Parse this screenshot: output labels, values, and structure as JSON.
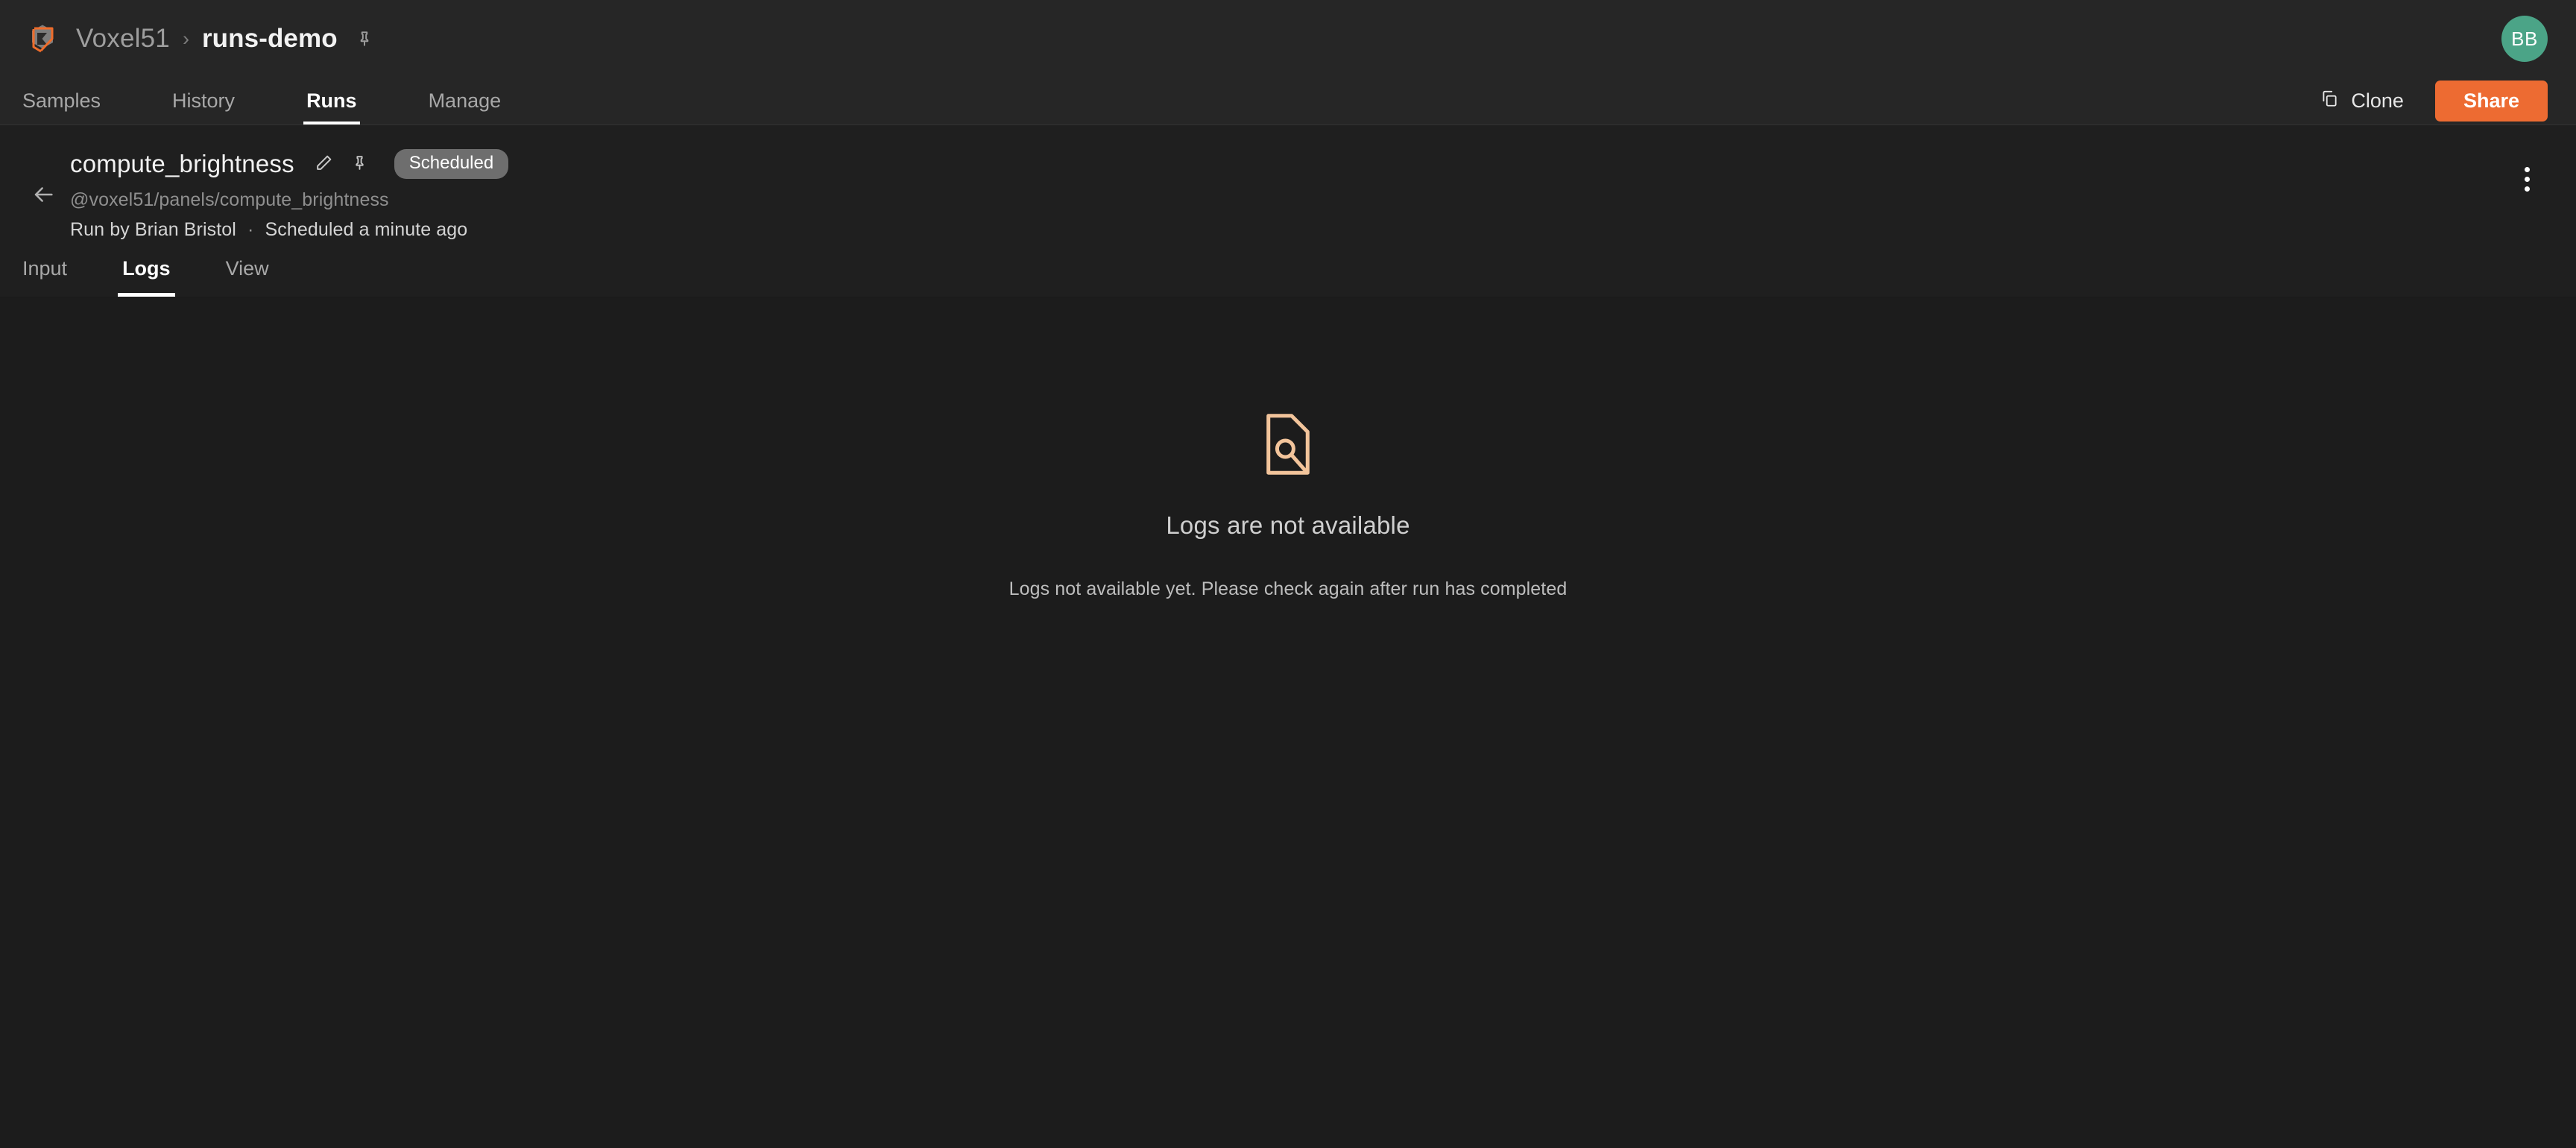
{
  "topbar": {
    "logo": "voxel51-logo",
    "breadcrumb": {
      "org": "Voxel51",
      "separator": "›",
      "current": "runs-demo",
      "pin_icon": "pin-icon"
    },
    "avatar_initials": "BB",
    "avatar_color": "#4ba487"
  },
  "nav": {
    "tabs": [
      {
        "label": "Samples",
        "active": false
      },
      {
        "label": "History",
        "active": false
      },
      {
        "label": "Runs",
        "active": true
      },
      {
        "label": "Manage",
        "active": false
      }
    ],
    "clone_label": "Clone",
    "clone_icon": "copy-icon",
    "share_label": "Share",
    "share_color": "#ed6b32"
  },
  "run": {
    "back_icon": "arrow-left-icon",
    "title": "compute_brightness",
    "edit_icon": "pencil-icon",
    "pin_icon": "pin-icon",
    "status": "Scheduled",
    "status_color": "#6e6e6e",
    "uri": "@voxel51/panels/compute_brightness",
    "run_by": "Run by Brian Bristol",
    "meta_separator": "·",
    "scheduled_at": "Scheduled a minute ago",
    "more_icon": "kebab-menu-icon"
  },
  "subtabs": [
    {
      "label": "Input",
      "active": false
    },
    {
      "label": "Logs",
      "active": true
    },
    {
      "label": "View",
      "active": false
    }
  ],
  "empty_state": {
    "icon": "document-search-icon",
    "icon_color": "#f2c49b",
    "title": "Logs are not available",
    "description": "Logs not available yet. Please check again after run has completed"
  }
}
